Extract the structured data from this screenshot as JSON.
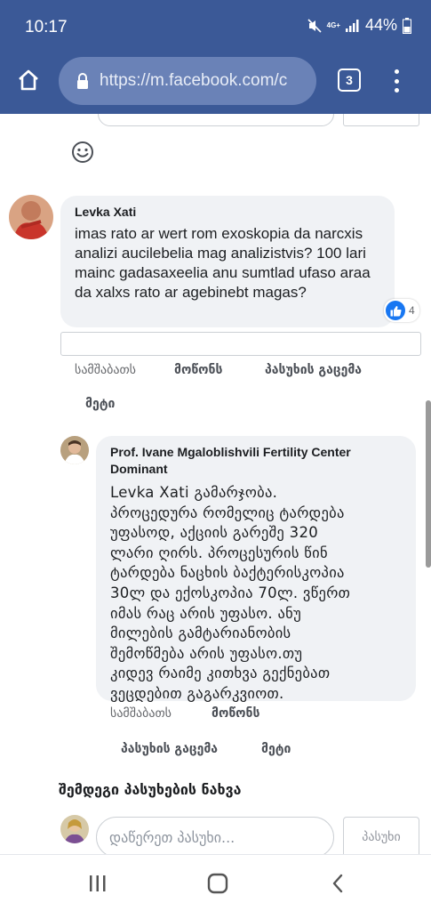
{
  "status_bar": {
    "time": "10:17",
    "network": "4G+",
    "battery": "44%"
  },
  "browser": {
    "url": "https://m.facebook.com/c",
    "tab_count": "3"
  },
  "comment": {
    "author": "Levka Xati",
    "text": "imas rato ar wert rom exoskopia da narcxis analizi aucilebelia mag analizistvis? 100 lari mainc gadasaxeelia anu sumtlad ufaso araa da xalxs rato ar agebinebt magas?",
    "reaction_count": "4",
    "actions": {
      "date": "სამშაბათს",
      "like": "მოწონს",
      "reply": "პასუხის გაცემა",
      "more": "მეტი"
    }
  },
  "reply": {
    "author_line1": "Prof. Ivane Mgaloblishvili Fertility Center",
    "author_line2": "Dominant",
    "lines": [
      "Levka Xati გამარჯობა.",
      "პროცედურა რომელიც ტარდება",
      "უფასოდ, აქციის გარეშე 320",
      "ლარი ღირს. პროცესურის წინ",
      "ტარდება ნაცხის ბაქტერისკოპია",
      "30ლ და ექოსკოპია 70ლ. ვწერთ",
      "იმას რაც არის უფასო. ანუ",
      "მილების გამტარიანობის",
      "შემოწმება არის უფასო.თუ",
      "კიდევ რაიმე კითხვა გექნებათ",
      "ვეცდებით გაგარკვიოთ."
    ],
    "actions": {
      "date": "სამშაბათს",
      "like": "მოწონს",
      "reply": "პასუხის გაცემა",
      "more": "მეტი"
    }
  },
  "more_replies": "შემდეგი პასუხების ნახვა",
  "write_reply": {
    "placeholder": "დაწერეთ პასუხი...",
    "button": "პასუხი"
  },
  "icons": {
    "home": "home-icon",
    "lock": "lock-icon",
    "menu": "more-vert-icon",
    "smiley": "emoji-icon",
    "like": "like-icon",
    "recent": "recent-apps-icon",
    "home_nav": "home-nav-icon",
    "back": "back-icon"
  },
  "colors": {
    "brand": "#3b5997",
    "bubble": "#f0f2f5",
    "like": "#1877f2"
  }
}
